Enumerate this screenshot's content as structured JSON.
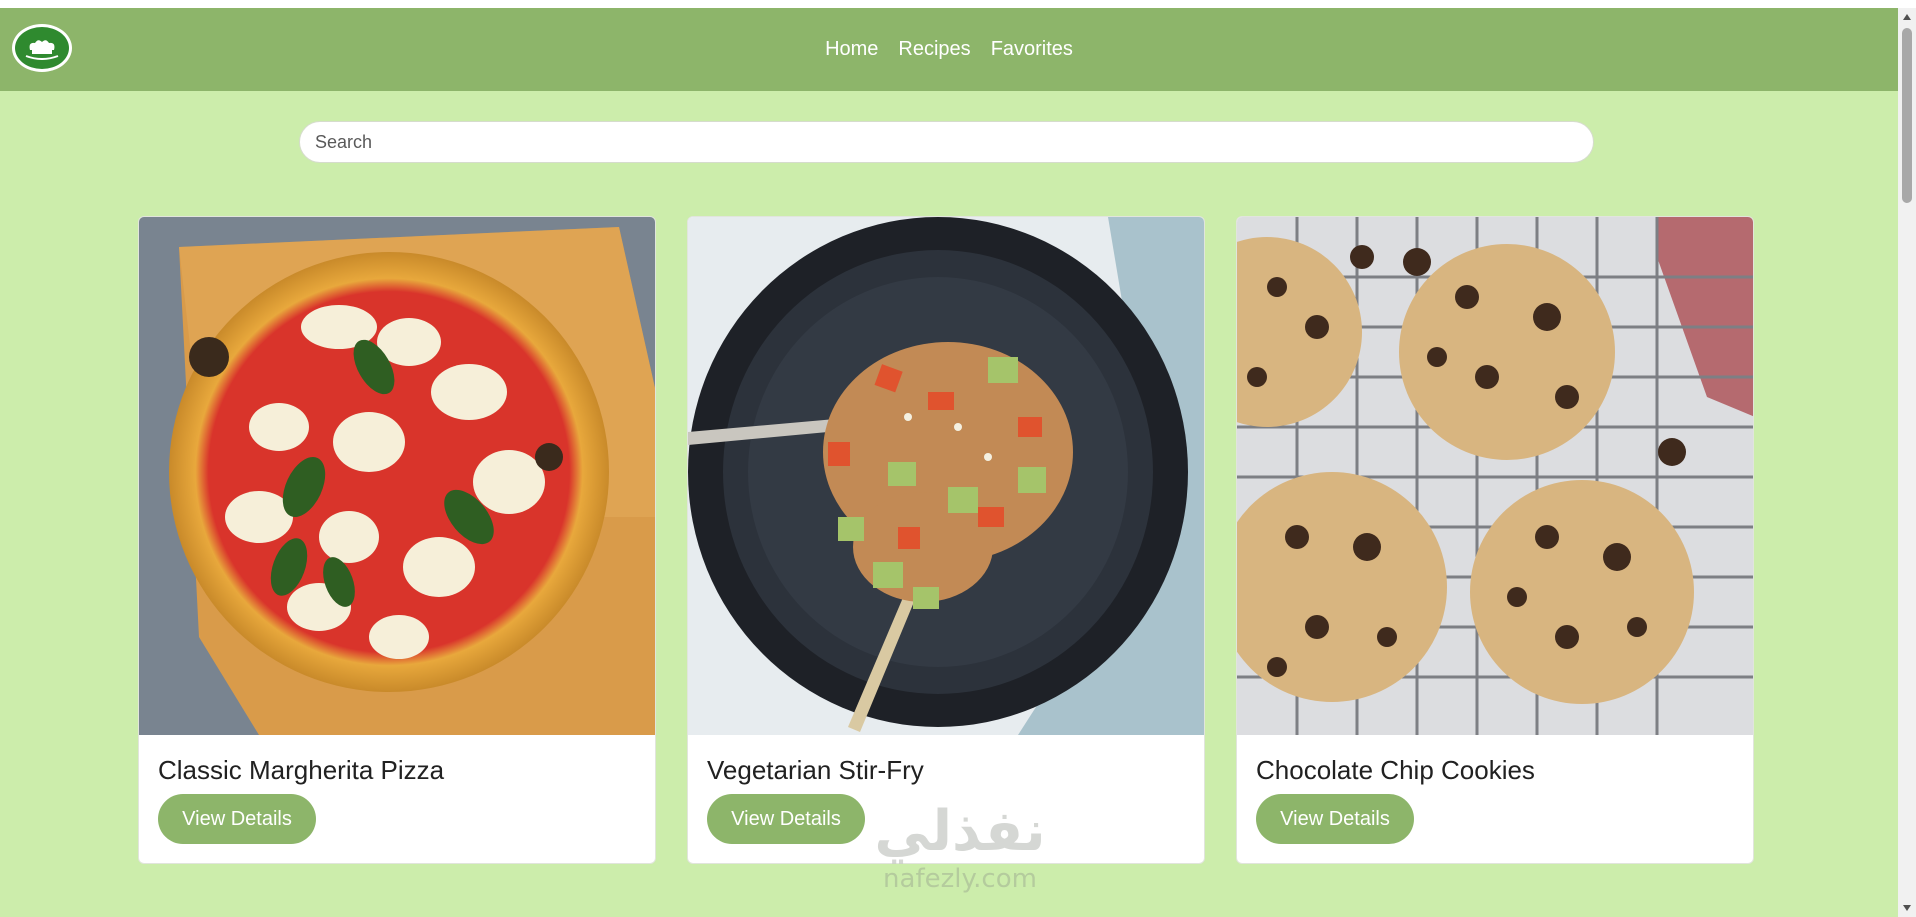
{
  "nav": {
    "logo_icon": "chef-hat-logo",
    "links": [
      "Home",
      "Recipes",
      "Favorites"
    ]
  },
  "search": {
    "placeholder": "Search",
    "value": ""
  },
  "recipes": [
    {
      "title": "Classic Margherita Pizza",
      "button": "View Details",
      "image_icon": "pizza-photo"
    },
    {
      "title": "Vegetarian Stir-Fry",
      "button": "View Details",
      "image_icon": "stir-fry-photo"
    },
    {
      "title": "Chocolate Chip Cookies",
      "button": "View Details",
      "image_icon": "cookies-photo"
    }
  ],
  "watermark": {
    "text": "نفذلي",
    "subtext": "nafezly.com"
  },
  "colors": {
    "page_background": "#ccedab",
    "navbar": "#8db56a",
    "button": "#8db56a",
    "card": "#ffffff"
  }
}
